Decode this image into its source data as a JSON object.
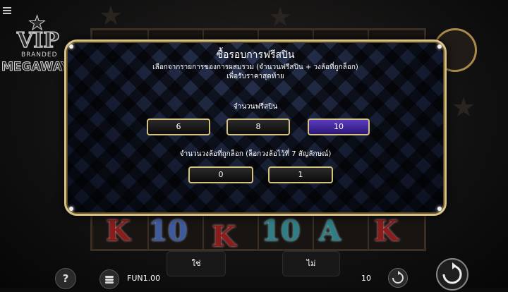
{
  "modal": {
    "title": "ซื้อรอบการฟรีสปิน",
    "description_line1": "เลือกจากรายการของการผสมรวม (จำนวนฟรีสปิน + วงล้อที่ถูกล็อก)",
    "description_line2": "เพื่อรับราคาสุดท้าย",
    "free_spins_label": "จำนวนฟรีสปิน",
    "free_spins_options": [
      "6",
      "8",
      "10"
    ],
    "free_spins_selected": "10",
    "locked_reels_label": "จำนวนวงล้อที่ถูกล็อก (ล็อกวงล้อไว้ที่ 7 สัญลักษณ์)",
    "locked_reels_options": [
      "0",
      "1"
    ],
    "selected_color": "#4a2ea6",
    "border_color": "#d8c282"
  },
  "actions": {
    "yes_label": "ใช่",
    "no_label": "ไม่"
  },
  "bottom_bar": {
    "help_label": "?",
    "balance": "FUN1.00",
    "bet": "10"
  },
  "logo": {
    "line1": "VIP",
    "line2": "BRANDED",
    "line3": "MEGAWAYS"
  },
  "reel_symbols": [
    "K",
    "10",
    "K",
    "10",
    "A",
    "K"
  ]
}
